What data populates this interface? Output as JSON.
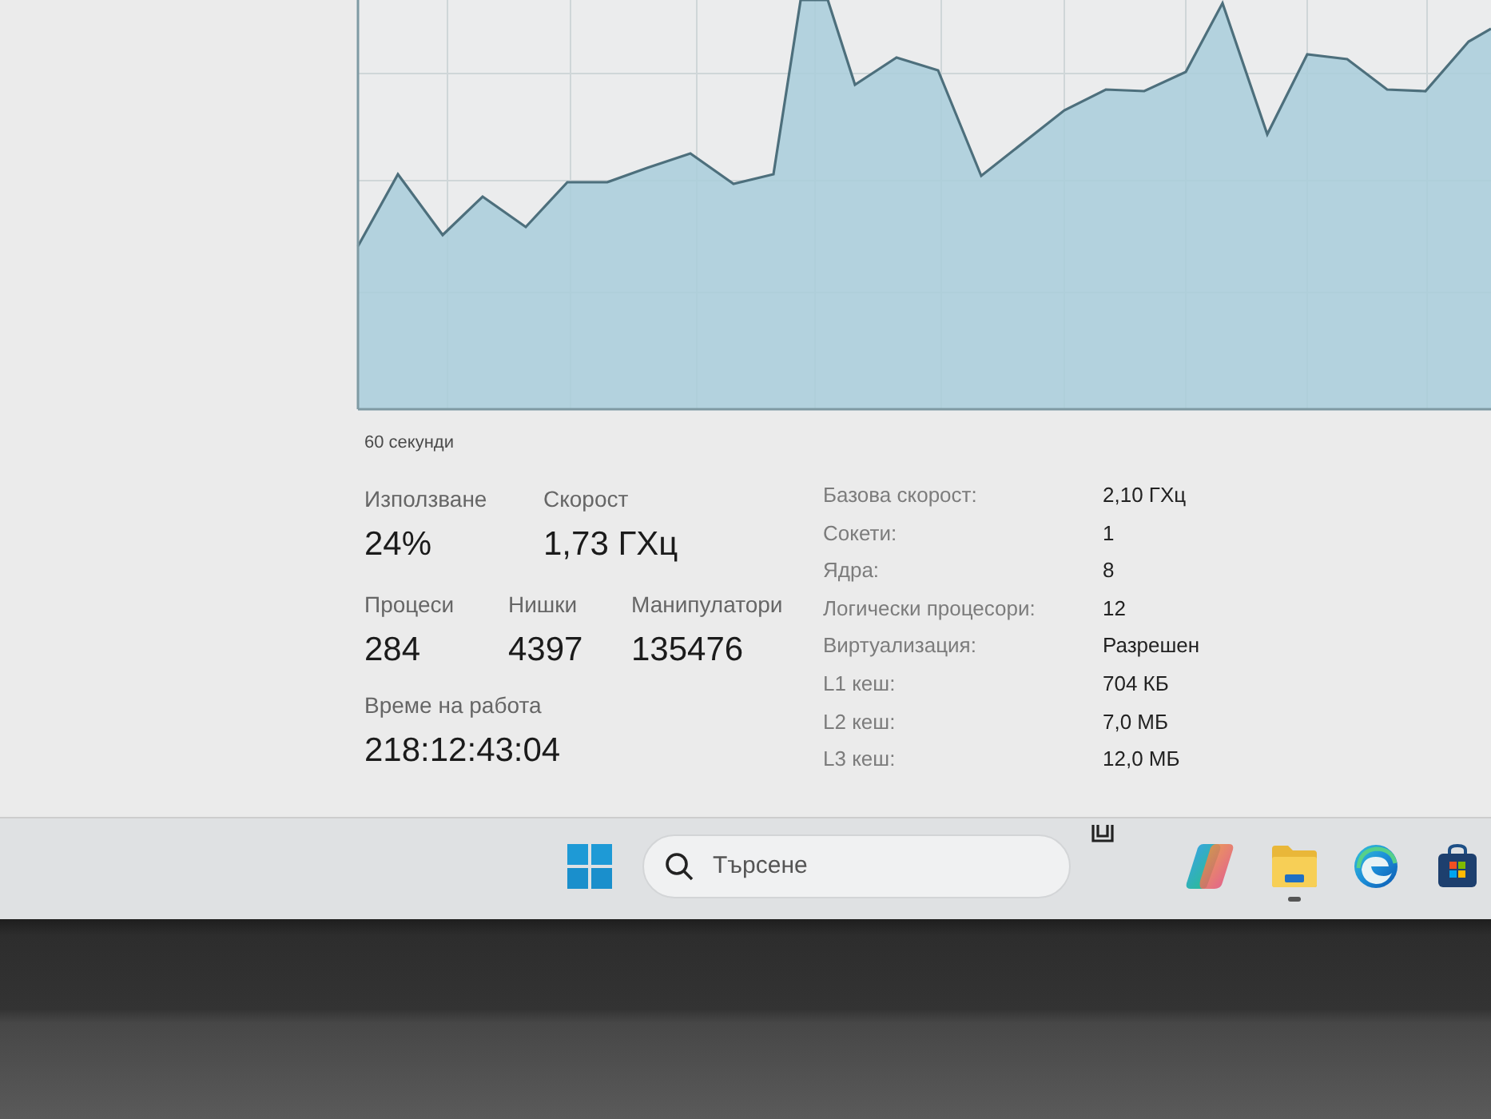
{
  "graph": {
    "time_label": "60 секунди"
  },
  "stats": [
    {
      "items": [
        {
          "label": "Използване",
          "value": "24%"
        },
        {
          "label": "Скорост",
          "value": "1,73 ГХц"
        }
      ]
    },
    {
      "items": [
        {
          "label": "Процеси",
          "value": "284"
        },
        {
          "label": "Нишки",
          "value": "4397"
        },
        {
          "label": "Манипулатори",
          "value": "135476"
        }
      ]
    },
    {
      "items": [
        {
          "label": "Време на работа",
          "value": "218:12:43:04"
        }
      ]
    }
  ],
  "details": [
    {
      "label": "Базова скорост:",
      "value": "2,10 ГХц"
    },
    {
      "label": "Сокети:",
      "value": "1"
    },
    {
      "label": "Ядра:",
      "value": "8"
    },
    {
      "label": "Логически процесори:",
      "value": "12"
    },
    {
      "label": "Виртуализация:",
      "value": "Разрешен"
    },
    {
      "label": "L1 кеш:",
      "value": "704 КБ"
    },
    {
      "label": "L2 кеш:",
      "value": "7,0 МБ"
    },
    {
      "label": "L3 кеш:",
      "value": "12,0 МБ"
    }
  ],
  "taskbar": {
    "search": {
      "placeholder": "Търсене"
    },
    "apps": [
      {
        "kind": "copilot",
        "running": false
      },
      {
        "kind": "file_explorer",
        "running": true
      },
      {
        "kind": "edge",
        "running": false
      },
      {
        "kind": "store",
        "running": false
      }
    ]
  }
}
